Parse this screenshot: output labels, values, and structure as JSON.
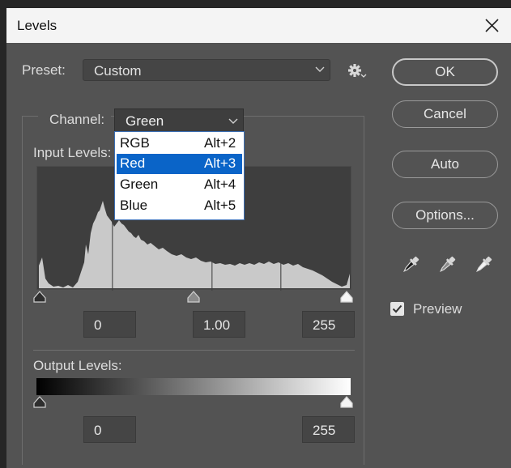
{
  "window": {
    "title": "Levels"
  },
  "preset": {
    "label": "Preset:",
    "value": "Custom"
  },
  "buttons": {
    "ok": "OK",
    "cancel": "Cancel",
    "auto": "Auto",
    "options": "Options..."
  },
  "channel": {
    "label": "Channel:",
    "value": "Green",
    "menu": [
      {
        "name": "RGB",
        "shortcut": "Alt+2"
      },
      {
        "name": "Red",
        "shortcut": "Alt+3",
        "highlighted": true
      },
      {
        "name": "Green",
        "shortcut": "Alt+4"
      },
      {
        "name": "Blue",
        "shortcut": "Alt+5"
      }
    ]
  },
  "input_levels": {
    "label": "Input Levels:",
    "black": "0",
    "gamma": "1.00",
    "white": "255"
  },
  "output_levels": {
    "label": "Output Levels:",
    "black": "0",
    "white": "255"
  },
  "preview": {
    "label": "Preview",
    "checked": true
  },
  "colors": {
    "highlight": "#0a64c8",
    "panel": "#535353",
    "histogram_bars": "#c9c9c9"
  }
}
